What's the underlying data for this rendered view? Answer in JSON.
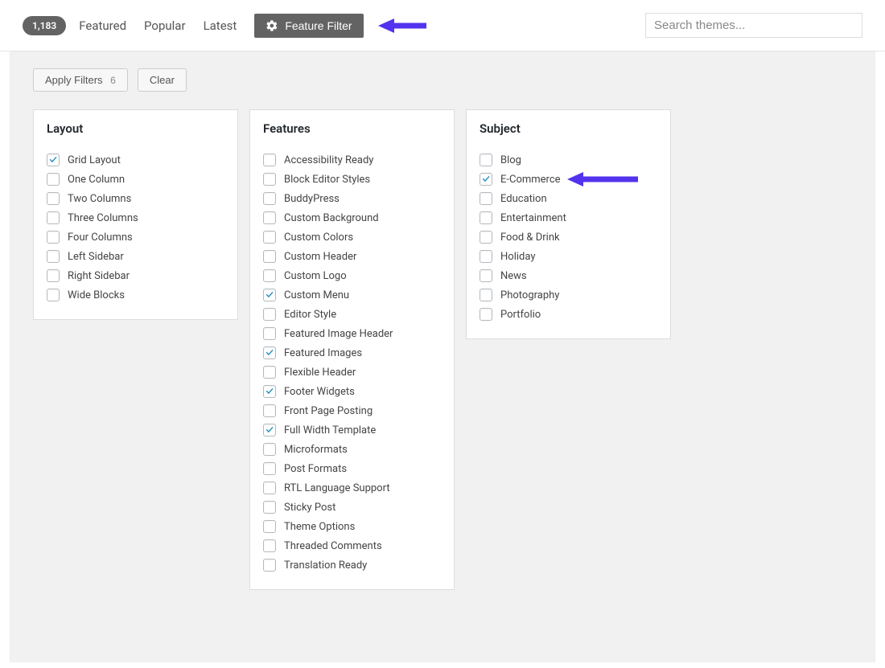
{
  "header": {
    "count": "1,183",
    "tabs": [
      "Featured",
      "Popular",
      "Latest"
    ],
    "feature_filter_label": "Feature Filter",
    "search_placeholder": "Search themes..."
  },
  "actions": {
    "apply_label": "Apply Filters",
    "apply_count": "6",
    "clear_label": "Clear"
  },
  "filters": {
    "layout": {
      "title": "Layout",
      "items": [
        {
          "label": "Grid Layout",
          "checked": true
        },
        {
          "label": "One Column",
          "checked": false
        },
        {
          "label": "Two Columns",
          "checked": false
        },
        {
          "label": "Three Columns",
          "checked": false
        },
        {
          "label": "Four Columns",
          "checked": false
        },
        {
          "label": "Left Sidebar",
          "checked": false
        },
        {
          "label": "Right Sidebar",
          "checked": false
        },
        {
          "label": "Wide Blocks",
          "checked": false
        }
      ]
    },
    "features": {
      "title": "Features",
      "items": [
        {
          "label": "Accessibility Ready",
          "checked": false
        },
        {
          "label": "Block Editor Styles",
          "checked": false
        },
        {
          "label": "BuddyPress",
          "checked": false
        },
        {
          "label": "Custom Background",
          "checked": false
        },
        {
          "label": "Custom Colors",
          "checked": false
        },
        {
          "label": "Custom Header",
          "checked": false
        },
        {
          "label": "Custom Logo",
          "checked": false
        },
        {
          "label": "Custom Menu",
          "checked": true
        },
        {
          "label": "Editor Style",
          "checked": false
        },
        {
          "label": "Featured Image Header",
          "checked": false
        },
        {
          "label": "Featured Images",
          "checked": true
        },
        {
          "label": "Flexible Header",
          "checked": false
        },
        {
          "label": "Footer Widgets",
          "checked": true
        },
        {
          "label": "Front Page Posting",
          "checked": false
        },
        {
          "label": "Full Width Template",
          "checked": true
        },
        {
          "label": "Microformats",
          "checked": false
        },
        {
          "label": "Post Formats",
          "checked": false
        },
        {
          "label": "RTL Language Support",
          "checked": false
        },
        {
          "label": "Sticky Post",
          "checked": false
        },
        {
          "label": "Theme Options",
          "checked": false
        },
        {
          "label": "Threaded Comments",
          "checked": false
        },
        {
          "label": "Translation Ready",
          "checked": false
        }
      ]
    },
    "subject": {
      "title": "Subject",
      "items": [
        {
          "label": "Blog",
          "checked": false
        },
        {
          "label": "E-Commerce",
          "checked": true
        },
        {
          "label": "Education",
          "checked": false
        },
        {
          "label": "Entertainment",
          "checked": false
        },
        {
          "label": "Food & Drink",
          "checked": false
        },
        {
          "label": "Holiday",
          "checked": false
        },
        {
          "label": "News",
          "checked": false
        },
        {
          "label": "Photography",
          "checked": false
        },
        {
          "label": "Portfolio",
          "checked": false
        }
      ]
    }
  }
}
